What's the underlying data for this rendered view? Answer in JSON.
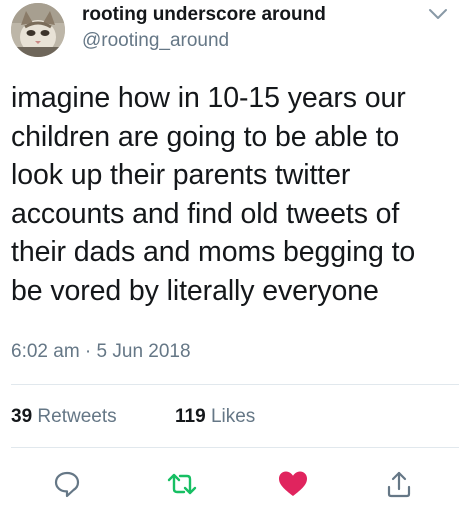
{
  "user": {
    "display_name": "rooting underscore around",
    "handle": "@rooting_around"
  },
  "tweet": {
    "lines": [
      "imagine how in 10-15 years our",
      "children are going to be able to",
      "look up their parents twitter",
      "accounts and find old tweets of",
      "their dads and moms begging to",
      "be vored by literally everyone"
    ],
    "timestamp": "6:02 am · 5 Jun 2018"
  },
  "stats": {
    "retweets_count": "39",
    "retweets_label": "Retweets",
    "likes_count": "119",
    "likes_label": "Likes"
  },
  "icons": {
    "menu": "chevron-down-icon",
    "reply": "reply-icon",
    "retweet": "retweet-icon",
    "like": "heart-icon",
    "share": "share-icon"
  },
  "colors": {
    "retweet": "#17bf63",
    "like": "#e0245e",
    "secondary_text": "#657786",
    "icon_gray": "#657786"
  }
}
